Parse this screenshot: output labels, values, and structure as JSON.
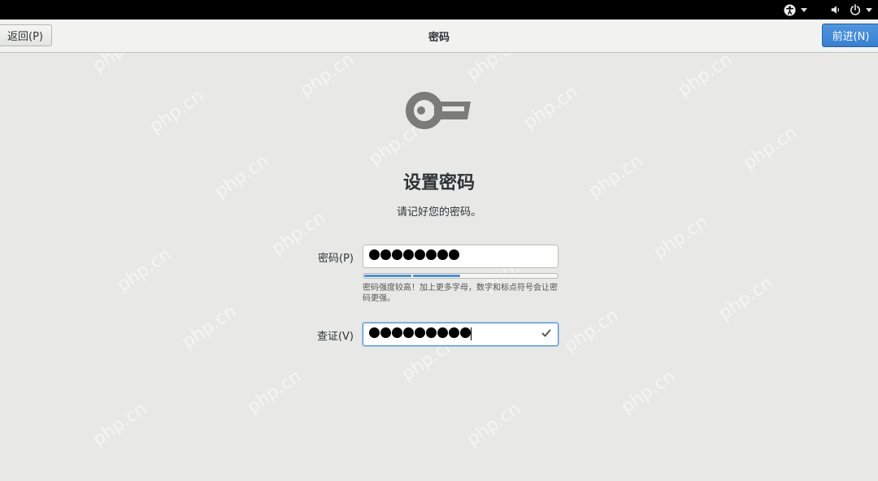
{
  "topbar": {
    "accessibility_icon": "accessibility-icon",
    "volume_icon": "volume-icon",
    "power_icon": "power-icon"
  },
  "header": {
    "back_label": "返回(P)",
    "title": "密码",
    "next_label": "前进(N)"
  },
  "page": {
    "icon": "key-icon",
    "title": "设置密码",
    "subtitle": "请记好您的密码。"
  },
  "password": {
    "label": "密码(P)",
    "dot_count": 8,
    "strength_level": 0.5,
    "hint": "密码强度较高！加上更多字母，数字和标点符号会让密码更强。"
  },
  "confirm": {
    "label": "查证(V)",
    "dot_count": 9,
    "valid_icon": "checkmark-icon"
  },
  "watermark": "php.cn",
  "colors": {
    "accent": "#4a90d9",
    "background": "#e8e8e7",
    "topbar": "#000000"
  }
}
